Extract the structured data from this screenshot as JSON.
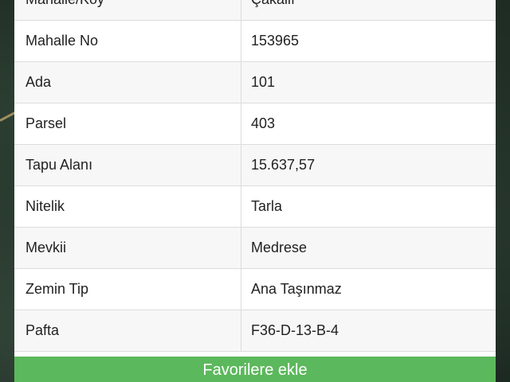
{
  "parcel_table": {
    "rows": [
      {
        "label": "Mahalle/Köy",
        "value": "Çakallı"
      },
      {
        "label": "Mahalle No",
        "value": "153965"
      },
      {
        "label": "Ada",
        "value": "101"
      },
      {
        "label": "Parsel",
        "value": "403"
      },
      {
        "label": "Tapu Alanı",
        "value": "15.637,57"
      },
      {
        "label": "Nitelik",
        "value": "Tarla"
      },
      {
        "label": "Mevkii",
        "value": "Medrese"
      },
      {
        "label": "Zemin Tip",
        "value": "Ana Taşınmaz"
      },
      {
        "label": "Pafta",
        "value": "F36-D-13-B-4"
      }
    ]
  },
  "action_button": {
    "label": "Favorilere ekle"
  },
  "colors": {
    "button_green": "#5cb85c",
    "row_alt": "#f7f7f7",
    "border": "#dcdcdc"
  }
}
